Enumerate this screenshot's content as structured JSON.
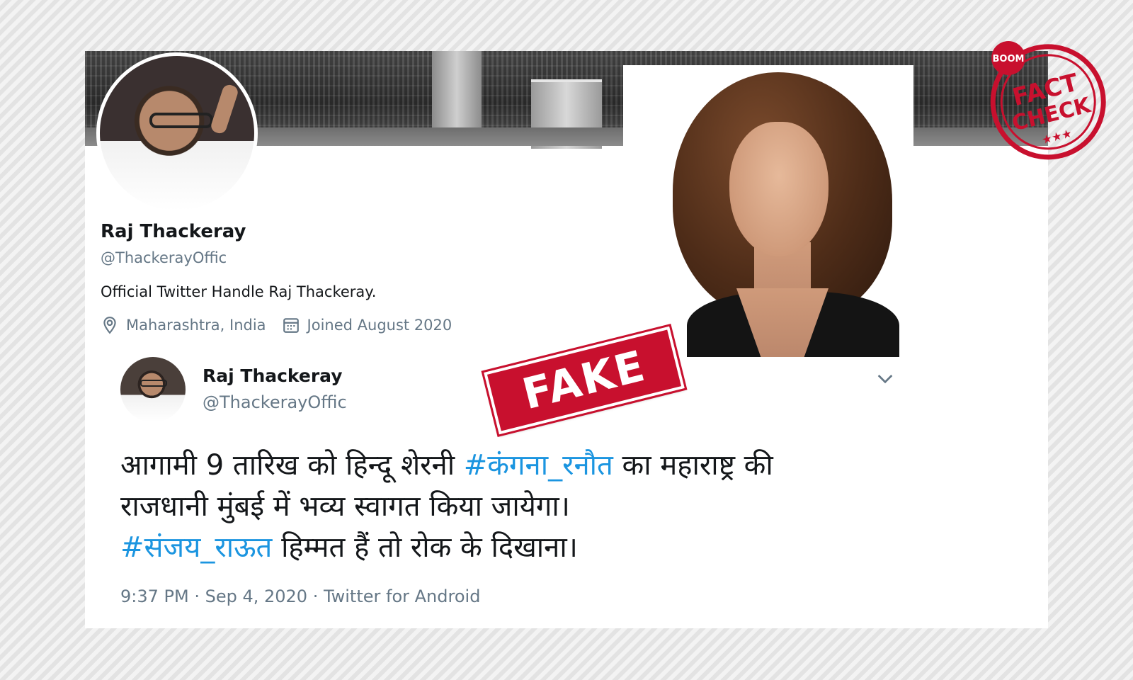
{
  "profile": {
    "name": "Raj Thackeray",
    "handle": "@ThackerayOffic",
    "bio": "Official Twitter Handle Raj Thackeray.",
    "location": "Maharashtra, India",
    "joined": "Joined August 2020"
  },
  "tweet": {
    "name": "Raj Thackeray",
    "handle": "@ThackerayOffic",
    "line1_before": "आगामी 9 तारिख को हिन्दू शेरनी ",
    "line1_hashtag": "#कंगना_रनौत",
    "line1_after": " का महाराष्ट्र की",
    "line2": "राजधानी मुंबई में भव्य स्वागत किया जायेगा।",
    "line3_hashtag": "#संजय_राऊत",
    "line3_after": " हिम्मत हैं तो रोक के दिखाना।",
    "footer": "9:37 PM · Sep 4, 2020 · Twitter for Android"
  },
  "overlays": {
    "fake_stamp": "FAKE",
    "fact_check_badge_brand": "BOOM",
    "fact_check_badge_line1": "FACT",
    "fact_check_badge_line2": "CHECK"
  },
  "colors": {
    "hashtag": "#1b95e0",
    "stamp_red": "#c8102e",
    "secondary_text": "#657786",
    "primary_text": "#14171a"
  },
  "icons": [
    "location-pin-icon",
    "calendar-icon",
    "chevron-down-icon"
  ]
}
